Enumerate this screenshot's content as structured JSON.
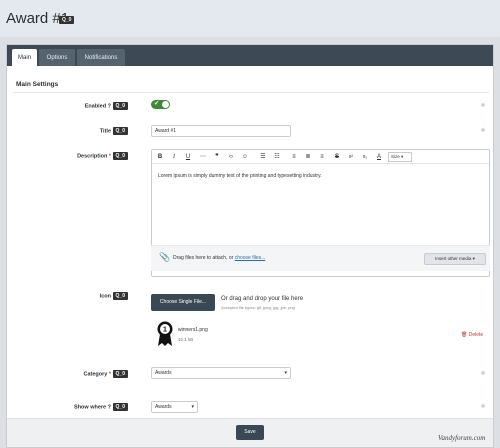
{
  "header": {
    "title": "Award #1",
    "id_badge": "Q_0"
  },
  "tabs": [
    "Main",
    "Options",
    "Notifications"
  ],
  "section_title": "Main Settings",
  "fields": {
    "enabled": {
      "label": "Enabled ?",
      "badge": "Q_0",
      "value": "on"
    },
    "title": {
      "label": "Title",
      "badge": "Q_0",
      "value": "Award #1"
    },
    "description": {
      "label": "Description",
      "required": "*",
      "badge": "Q_0",
      "text": "Lorem ipsum is simply dummy text of the printing and typesetting industry."
    },
    "icon": {
      "label": "Icon",
      "badge": "Q_0"
    },
    "category": {
      "label": "Category",
      "required": "*",
      "badge": "Q_0",
      "value": "Awards"
    },
    "show_where": {
      "label": "Show where ?",
      "badge": "Q_0",
      "value": "Awards"
    }
  },
  "editor": {
    "size_label": "Size",
    "attach_text": "Drag files here to attach, or",
    "attach_link": "choose files...",
    "insert_media": "Insert other media"
  },
  "upload": {
    "button": "Choose Single File...",
    "drop_text": "Or drag and drop your file here",
    "accepted": "Accepted file types: gif, jpeg, jpg, jpe, png",
    "file_name": "winners1.png",
    "file_size": "10.1 kB",
    "delete_label": "Delete"
  },
  "save_label": "Save",
  "watermark": "Vandyforum.com",
  "colors": {
    "tabbar": "#3d4a56",
    "toggle_on": "#3f8a36",
    "primary_button": "#3a4754",
    "link": "#2c6bb5",
    "danger": "#c0392b"
  }
}
